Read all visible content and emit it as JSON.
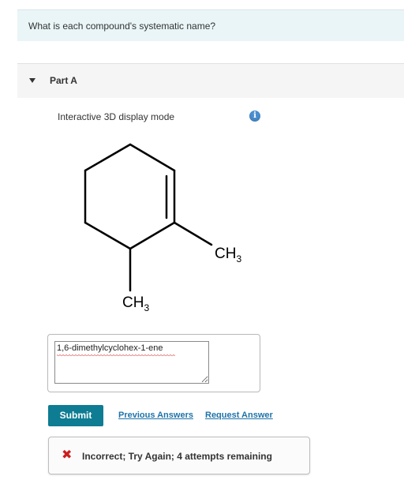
{
  "question": {
    "text": "What is each compound's systematic name?"
  },
  "part": {
    "title": "Part A",
    "display_mode_label": "Interactive 3D display mode",
    "info_icon_glyph": "i"
  },
  "molecule": {
    "labels": {
      "ch3_right": "CH",
      "ch3_right_sub": "3",
      "ch3_bottom": "CH",
      "ch3_bottom_sub": "3"
    }
  },
  "answer": {
    "value": "1,6-dimethylcyclohex-1-ene"
  },
  "actions": {
    "submit_label": "Submit",
    "previous_answers_label": "Previous Answers",
    "request_answer_label": "Request Answer"
  },
  "feedback": {
    "icon": "x-icon",
    "glyph": "✖",
    "text": "Incorrect; Try Again; 4 attempts remaining",
    "color": "#cc1f1f"
  },
  "colors": {
    "accent": "#0e7c93",
    "link": "#1e73a8",
    "question_bg": "#e9f5f7"
  }
}
